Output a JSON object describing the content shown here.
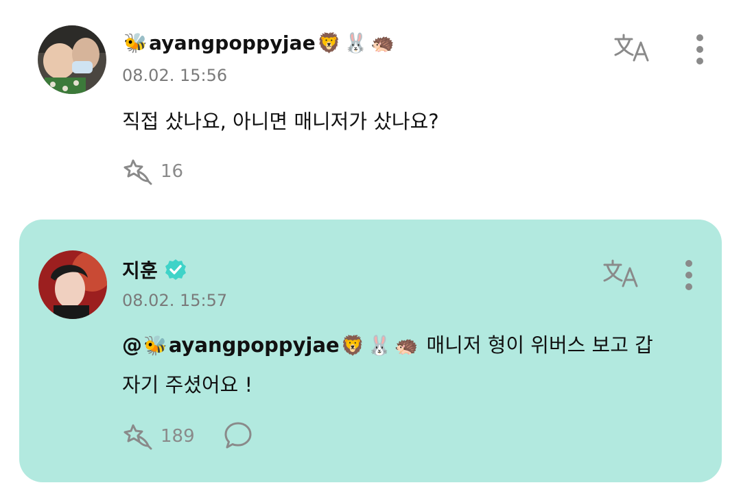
{
  "post": {
    "username": "ayangpoppyjae",
    "name_prefix_emoji": "🐝",
    "name_suffix_emojis": [
      "🦁",
      "🐰",
      "🦔"
    ],
    "timestamp": "08.02. 15:56",
    "text": "직접 샀나요, 아니면 매니저가 샀나요?",
    "like_count": "16"
  },
  "reply": {
    "username": "지훈",
    "verified": true,
    "timestamp": "08.02. 15:57",
    "mention_at": "@",
    "mention_prefix_emoji": "🐝",
    "mention_name": "ayangpoppyjae",
    "mention_suffix_emojis": [
      "🦁",
      "🐰",
      "🦔"
    ],
    "text_line1": "매니저 형이 위버스 보고 갑",
    "text_line2": "자기 주셨어요 !",
    "like_count": "189"
  },
  "colors": {
    "reply_background": "#b2e9df",
    "verified_badge": "#3fd3c8",
    "icon_gray": "#8a8a8a"
  }
}
